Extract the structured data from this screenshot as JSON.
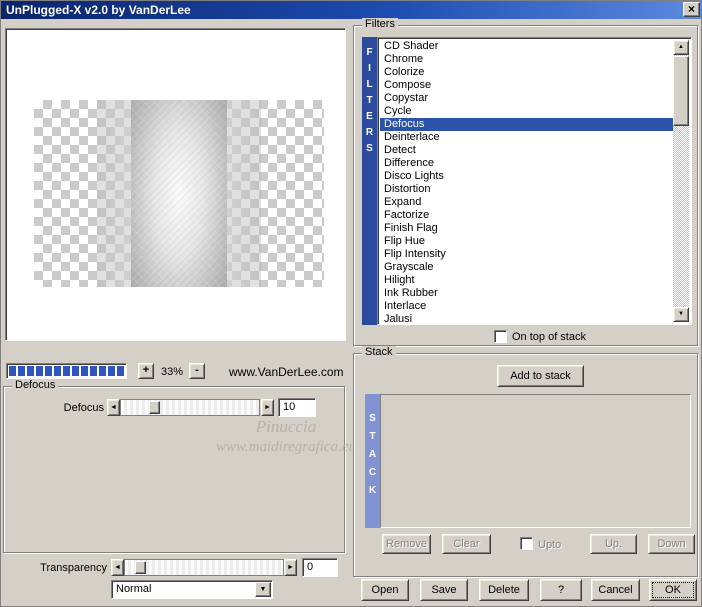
{
  "window": {
    "title": "UnPlugged-X v2.0 by VanDerLee"
  },
  "icons": {
    "close": "×",
    "left_arrow": "◄",
    "right_arrow": "►",
    "up_arrow": "▲",
    "down_arrow": "▼"
  },
  "preview": {
    "zoom_in_label": "+",
    "zoom_out_label": "-",
    "zoom_value": "33%",
    "website": "www.VanDerLee.com",
    "watermark1": "Pinuccia",
    "watermark2": "www.maidiregrafica.eu"
  },
  "defocus": {
    "group_title": "Defocus",
    "label": "Defocus",
    "value": "10"
  },
  "transparency": {
    "label": "Transparency",
    "value": "0"
  },
  "blend": {
    "selected": "Normal"
  },
  "filters": {
    "title": "Filters",
    "vertical_label": "FILTERS",
    "selected": "Defocus",
    "on_top_label": "On top of stack",
    "items": [
      "CD Shader",
      "Chrome",
      "Colorize",
      "Compose",
      "Copystar",
      "Cycle",
      "Defocus",
      "Deinterlace",
      "Detect",
      "Difference",
      "Disco Lights",
      "Distortion",
      "Expand",
      "Factorize",
      "Finish Flag",
      "Flip Hue",
      "Flip Intensity",
      "Grayscale",
      "Hilight",
      "Ink Rubber",
      "Interlace",
      "Jalusi"
    ],
    "selection_color": "#2b53a8",
    "bar_color": "#2c4a9e"
  },
  "stack": {
    "title": "Stack",
    "vertical_label": "STACK",
    "add_label": "Add to stack",
    "remove_label": "Remove",
    "clear_label": "Clear",
    "upto_label": "Upto",
    "up_label": "Up.",
    "down_label": "Down",
    "bar_color": "#8193d2"
  },
  "actions": {
    "open": "Open",
    "save": "Save",
    "delete": "Delete",
    "help": "?",
    "cancel": "Cancel",
    "ok": "OK"
  }
}
